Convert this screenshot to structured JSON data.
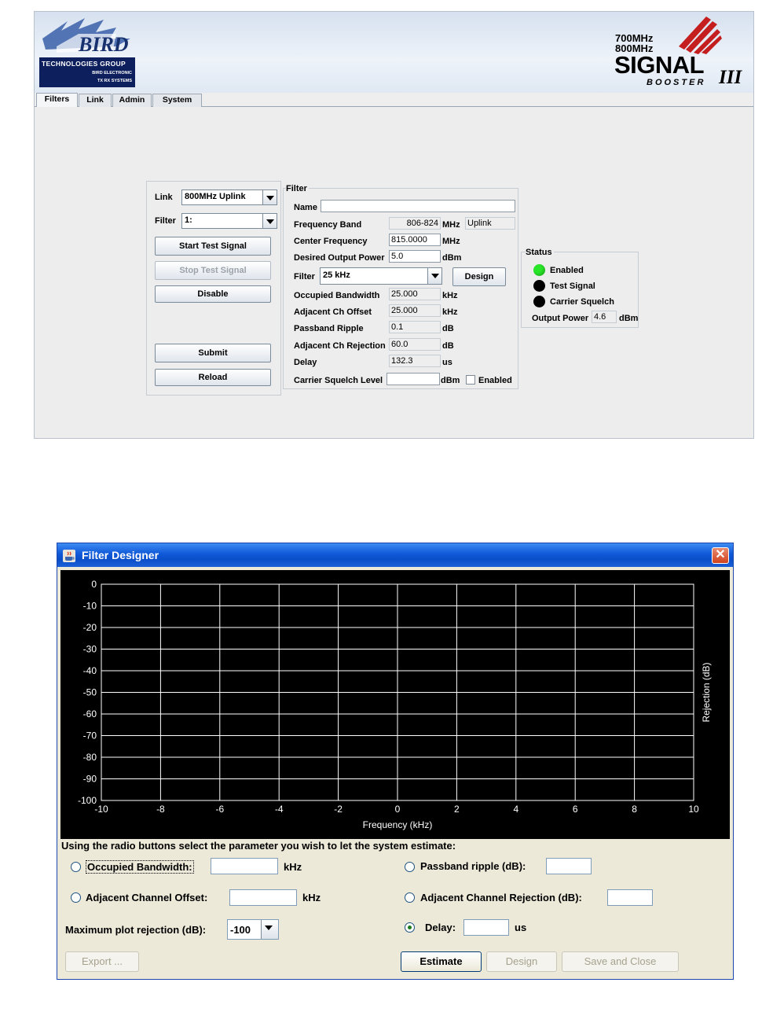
{
  "app": {
    "logo": {
      "name": "TECHNOLOGIES GROUP",
      "line2": "BIRD ELECTRONIC",
      "line3": "TX RX SYSTEMS"
    },
    "brand": {
      "band1": "700MHz",
      "band2": "800MHz",
      "product": "SIGNAL",
      "sub": "BOOSTER",
      "version": "III"
    },
    "tabs": [
      "Filters",
      "Link",
      "Admin",
      "System"
    ],
    "left_panel": {
      "link_label": "Link",
      "link_value": "800MHz Uplink",
      "filter_label": "Filter",
      "filter_value": "1:",
      "buttons": {
        "start_test": "Start Test Signal",
        "stop_test": "Stop Test Signal",
        "disable": "Disable",
        "submit": "Submit",
        "reload": "Reload"
      }
    },
    "filter_panel": {
      "title": "Filter",
      "name_label": "Name",
      "name_value": "",
      "frequency_band_label": "Frequency Band",
      "frequency_band_value": "806-824",
      "frequency_band_unit": "MHz",
      "frequency_band_dir": "Uplink",
      "center_freq_label": "Center Frequency",
      "center_freq_value": "815.0000",
      "center_freq_unit": "MHz",
      "desired_power_label": "Desired Output Power",
      "desired_power_value": "5.0",
      "desired_power_unit": "dBm",
      "filter_label": "Filter",
      "filter_value": "25 kHz",
      "design_button": "Design",
      "occ_bw_label": "Occupied Bandwidth",
      "occ_bw_value": "25.000",
      "occ_bw_unit": "kHz",
      "adj_offset_label": "Adjacent Ch Offset",
      "adj_offset_value": "25.000",
      "adj_offset_unit": "kHz",
      "ripple_label": "Passband Ripple",
      "ripple_value": "0.1",
      "ripple_unit": "dB",
      "adj_rej_label": "Adjacent Ch Rejection",
      "adj_rej_value": "60.0",
      "adj_rej_unit": "dB",
      "delay_label": "Delay",
      "delay_value": "132.3",
      "delay_unit": "us",
      "squelch_label": "Carrier Squelch Level",
      "squelch_value": "",
      "squelch_unit": "dBm",
      "squelch_enabled_label": "Enabled",
      "squelch_enabled": false
    },
    "status_panel": {
      "title": "Status",
      "enabled_label": "Enabled",
      "enabled_color": "#29e629",
      "test_signal_label": "Test Signal",
      "test_signal_color": "#000000",
      "carrier_squelch_label": "Carrier Squelch",
      "carrier_squelch_color": "#000000",
      "output_power_label": "Output Power",
      "output_power_value": "4.6",
      "output_power_unit": "dBm"
    }
  },
  "dialog": {
    "title": "Filter Designer",
    "close_icon": "close-icon",
    "instructions": "Using the radio buttons select the parameter you wish to let the system estimate:",
    "params": {
      "occ_bw_label": "Occupied Bandwidth:",
      "occ_bw_unit": "kHz",
      "adj_offset_label": "Adjacent Channel Offset:",
      "adj_offset_unit": "kHz",
      "max_rej_label": "Maximum plot rejection (dB):",
      "max_rej_value": "-100",
      "ripple_label": "Passband ripple (dB):",
      "adj_rej_label": "Adjacent Channel Rejection (dB):",
      "delay_label": "Delay:",
      "delay_unit": "us",
      "selected": "delay"
    },
    "buttons": {
      "export": "Export ...",
      "estimate": "Estimate",
      "design": "Design",
      "save_close": "Save and Close"
    }
  },
  "chart_data": {
    "type": "line",
    "title": "",
    "xlabel": "Frequency (kHz)",
    "ylabel": "Rejection (dB)",
    "xlim": [
      -10,
      10
    ],
    "ylim": [
      -100,
      0
    ],
    "x_ticks": [
      -10,
      -8,
      -6,
      -4,
      -2,
      0,
      2,
      4,
      6,
      8,
      10
    ],
    "y_ticks": [
      0,
      -10,
      -20,
      -30,
      -40,
      -50,
      -60,
      -70,
      -80,
      -90,
      -100
    ],
    "grid": true,
    "series": [],
    "background": "#000000",
    "grid_color": "#ffffff"
  }
}
